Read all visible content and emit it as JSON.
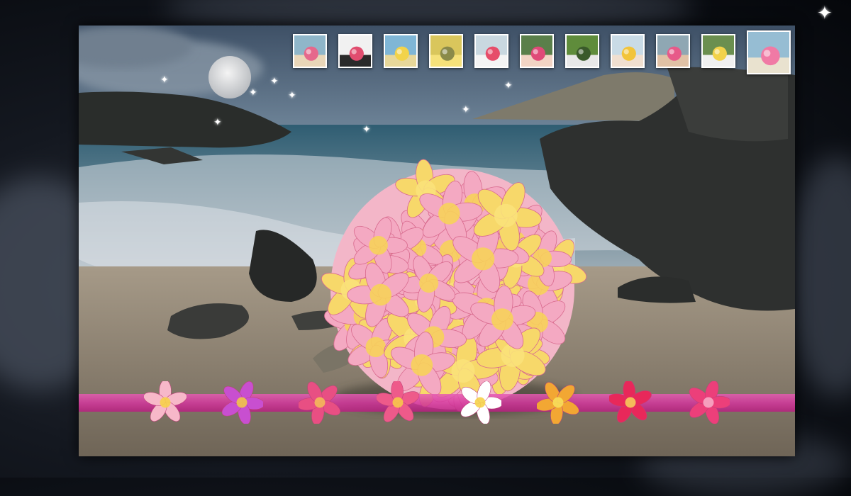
{
  "gallery": {
    "thumbnails": [
      {
        "name": "thumb-bouquet-beach"
      },
      {
        "name": "thumb-couple-bouquet"
      },
      {
        "name": "thumb-beach-ceremony"
      },
      {
        "name": "thumb-yellow-bouquet"
      },
      {
        "name": "thumb-bride-umbrella"
      },
      {
        "name": "thumb-bride-bouquet"
      },
      {
        "name": "thumb-couple-garden"
      },
      {
        "name": "thumb-couple-kiss"
      },
      {
        "name": "thumb-smiling-bride"
      },
      {
        "name": "thumb-couple-lei"
      },
      {
        "name": "thumb-plumeria-bouquet",
        "active": true
      }
    ]
  },
  "nav_flowers": [
    {
      "name": "nav-flower-1",
      "color": "#f7b8c9",
      "center": "#f6d24a"
    },
    {
      "name": "nav-flower-2",
      "color": "#c84fd0",
      "center": "#f0c44a"
    },
    {
      "name": "nav-flower-3",
      "color": "#e84f83",
      "center": "#f4b85a"
    },
    {
      "name": "nav-flower-4",
      "color": "#ee5a8a",
      "center": "#f7c84a"
    },
    {
      "name": "nav-flower-5",
      "color": "#ffffff",
      "center": "#f6d24a"
    },
    {
      "name": "nav-flower-6",
      "color": "#f2a733",
      "center": "#f7df5a"
    },
    {
      "name": "nav-flower-7",
      "color": "#e8285a",
      "center": "#f6c95a"
    },
    {
      "name": "nav-flower-8",
      "color": "#ec3f7a",
      "center": "#f7a9c4"
    }
  ],
  "colors": {
    "ribbon": "#d4369d",
    "sky": "#4a6077",
    "sand": "#8d8170",
    "sea": "#6e8a9c"
  }
}
